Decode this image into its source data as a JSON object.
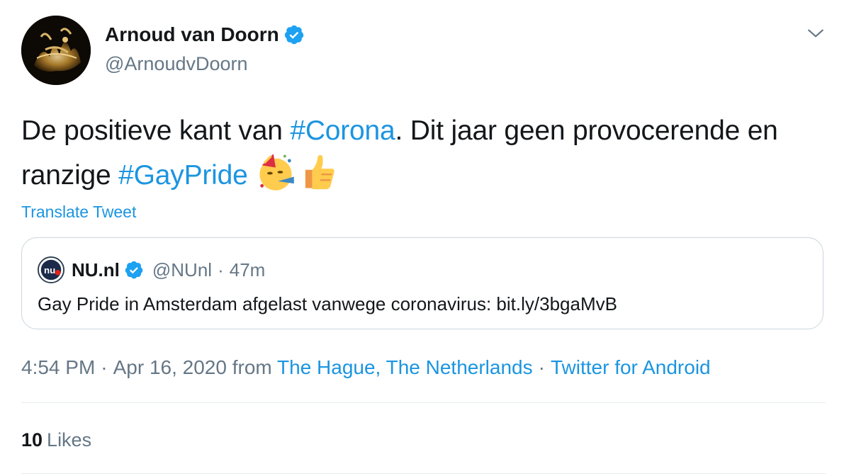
{
  "author": {
    "name": "Arnoud van Doorn",
    "handle": "@ArnoudvDoorn"
  },
  "tweet": {
    "text_part1": "De positieve kant van ",
    "hashtag1": "#Corona",
    "text_part2": ". Dit jaar geen provocerende en ranzige ",
    "hashtag2": "#GayPride",
    "emoji1": "party-face",
    "emoji2": "thumbs-up"
  },
  "translate_label": "Translate Tweet",
  "quoted": {
    "name": "NU.nl",
    "handle": "@NUnl",
    "separator": "·",
    "time": "47m",
    "text": "Gay Pride in Amsterdam afgelast vanwege coronavirus: bit.ly/3bgaMvB",
    "logo_text": "nu"
  },
  "meta": {
    "time": "4:54 PM",
    "sep1": "·",
    "date_from": "Apr 16, 2020 from",
    "location": "The Hague, The Netherlands",
    "sep2": "·",
    "source": "Twitter for Android"
  },
  "stats": {
    "likes_count": "10",
    "likes_label": "Likes"
  },
  "colors": {
    "link": "#1b95e0",
    "secondary_text": "#657786",
    "verified": "#1da1f2",
    "border": "#ccd6dd"
  }
}
